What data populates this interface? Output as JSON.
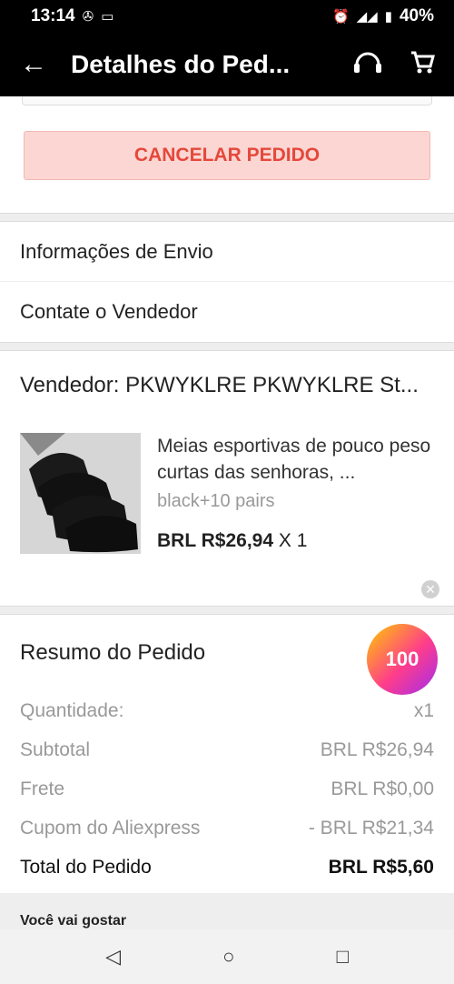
{
  "status_bar": {
    "time": "13:14",
    "battery": "40%"
  },
  "app_bar": {
    "title": "Detalhes do Ped..."
  },
  "actions": {
    "cancel_label": "CANCELAR PEDIDO"
  },
  "links": {
    "shipping_info": "Informações de Envio",
    "contact_seller": "Contate o Vendedor"
  },
  "order": {
    "seller": "Vendedor: PKWYKLRE PKWYKLRE St...",
    "product": {
      "name": "Meias esportivas de pouco peso curtas das senhoras, ...",
      "variant": "black+10 pairs",
      "price": "BRL R$26,94",
      "quantity": "X 1"
    }
  },
  "summary": {
    "title": "Resumo do Pedido",
    "badge": "100",
    "rows": [
      {
        "label": "Quantidade:",
        "value": "x1"
      },
      {
        "label": "Subtotal",
        "value": "BRL R$26,94"
      },
      {
        "label": "Frete",
        "value": "BRL R$0,00"
      },
      {
        "label": "Cupom do Aliexpress",
        "value": "- BRL R$21,34"
      }
    ],
    "total_label": "Total do Pedido",
    "total_value": "BRL R$5,60"
  },
  "recommend": {
    "title": "Você vai gostar"
  }
}
